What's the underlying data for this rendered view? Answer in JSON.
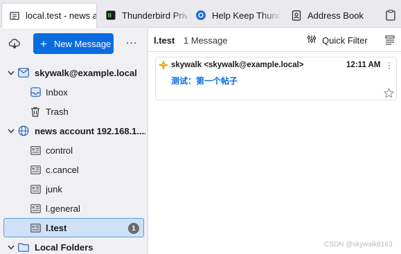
{
  "tabs": [
    {
      "label": "local.test - news a",
      "icon": "newsgroup-icon",
      "active": true
    },
    {
      "label": "Thunderbird Priva",
      "icon": "terminal-page-icon",
      "active": false
    },
    {
      "label": "Help Keep Thund",
      "icon": "firefox-globe-icon",
      "active": false
    },
    {
      "label": "Address Book",
      "icon": "address-book-icon",
      "active": false
    },
    {
      "label": "",
      "icon": "clipboard-icon",
      "active": false
    }
  ],
  "toolbar": {
    "new_message_label": "New Message",
    "more_label": "..."
  },
  "folders": [
    {
      "label": "skywalk@example.local",
      "type": "account",
      "icon": "mail-account-icon",
      "expanded": true
    },
    {
      "label": "Inbox",
      "type": "folder",
      "icon": "inbox-icon"
    },
    {
      "label": "Trash",
      "type": "folder",
      "icon": "trash-icon"
    },
    {
      "label": "news account 192.168.1....",
      "type": "account",
      "icon": "globe-icon",
      "expanded": true
    },
    {
      "label": "control",
      "type": "newsgroup",
      "icon": "newsgroup-icon"
    },
    {
      "label": "c.cancel",
      "type": "newsgroup",
      "icon": "newsgroup-icon"
    },
    {
      "label": "junk",
      "type": "newsgroup",
      "icon": "newsgroup-icon"
    },
    {
      "label": "l.general",
      "type": "newsgroup",
      "icon": "newsgroup-icon"
    },
    {
      "label": "l.test",
      "type": "newsgroup",
      "icon": "newsgroup-icon",
      "selected": true,
      "unread": "1"
    },
    {
      "label": "Local Folders",
      "type": "account",
      "icon": "folder-icon",
      "expanded": true
    }
  ],
  "list_header": {
    "folder_name": "l.test",
    "message_count": "1 Message",
    "quick_filter_label": "Quick Filter"
  },
  "messages": [
    {
      "sender": "skywalk <skywalk@example.local>",
      "time": "12:11 AM",
      "subject": "测试：第一个帖子",
      "unread": true,
      "starred": false
    }
  ],
  "watermark": "CSDN @skywalk8163",
  "colors": {
    "accent": "#0a6ce0",
    "selection": "#cfe1f6",
    "selection_border": "#5b9bd6",
    "badge": "#6b6b70"
  }
}
